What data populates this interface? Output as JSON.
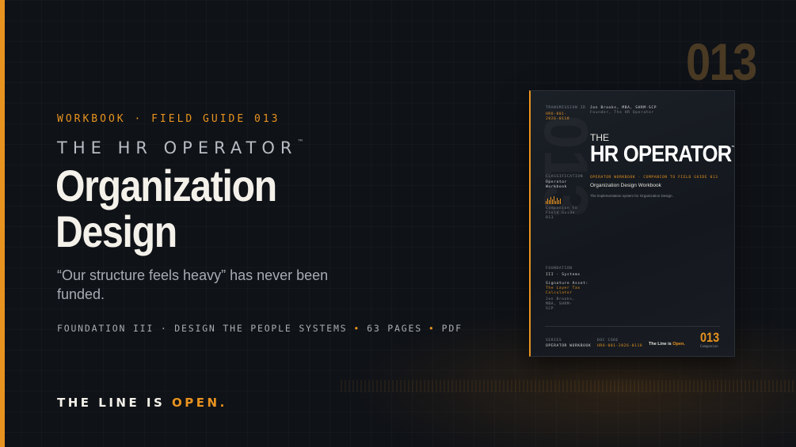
{
  "eyebrow": "WORKBOOK · FIELD GUIDE 013",
  "brand": {
    "name": "THE HR OPERATOR",
    "tm": "™"
  },
  "title": {
    "line1": "Organization",
    "line2": "Design"
  },
  "quote": "“Our structure feels heavy” has never been funded.",
  "meta": {
    "foundation": "FOUNDATION III · DESIGN THE PEOPLE SYSTEMS",
    "pages": "63 PAGES",
    "format": "PDF",
    "separator": "•"
  },
  "tagline": {
    "lead": "THE LINE IS",
    "accent": "OPEN."
  },
  "big_number": "013",
  "colors": {
    "accent": "#e8931f",
    "background": "#0f1217",
    "text": "#f4f1ea",
    "muted": "#a7abb3"
  },
  "cover": {
    "watermark": "013",
    "top_left_label": "TRANSMISSION ID",
    "top_left_value": "HRO-001-2026-0118",
    "author_line": "Jon Brooks, MBA, SHRM-SCP",
    "author_sub": "Founder, The HR Operator",
    "the": "THE",
    "title": "HR OPERATOR",
    "tm": "™",
    "series_line": "OPERATOR WORKBOOK · COMPANION TO FIELD GUIDE 013",
    "subtitle": "Organization Design Workbook",
    "description": "The implementation system for Organization Design.",
    "classification_label": "CLASSIFICATION",
    "classification_value": "Operator Workbook",
    "companion_note": "Companion to Field Guide 013",
    "foundation_label": "FOUNDATION",
    "foundation_value": "III · Systems",
    "signature_label": "Signature Asset:",
    "signature_value": "The Layer Tax Calculator",
    "signed_by": "Jon Brooks, MBA, SHRM-SCP",
    "footer_series_label": "SERIES",
    "footer_series_value": "OPERATOR WORKBOOK",
    "footer_doc_label": "DOC CODE",
    "footer_doc_value": "HRO-001-2026-0118",
    "footer_line": "The Line is",
    "footer_open": "Open.",
    "footer_num": "013",
    "footer_comp": "Companion"
  }
}
